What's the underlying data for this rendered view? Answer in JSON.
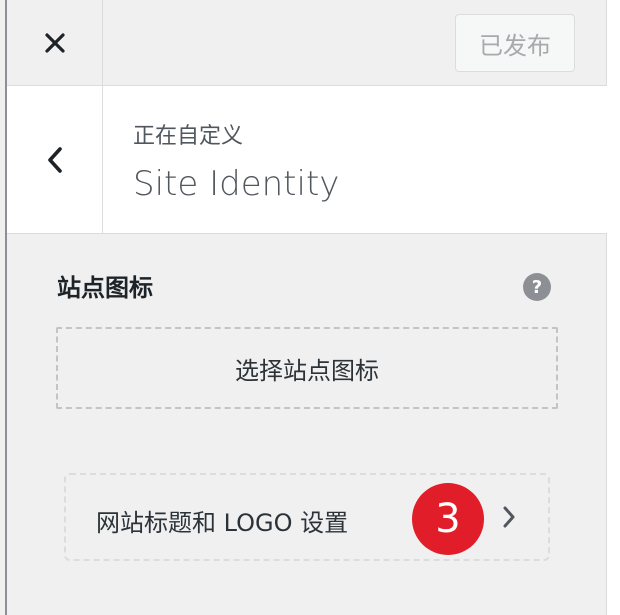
{
  "topbar": {
    "close_icon": "close-icon",
    "publish_label": "已发布"
  },
  "section": {
    "back_icon": "chevron-left-icon",
    "crumb": "正在自定义",
    "title": "Site Identity"
  },
  "site_icon": {
    "label": "站点图标",
    "help_icon": "help-icon",
    "help_glyph": "?",
    "select_label": "选择站点图标"
  },
  "title_logo": {
    "label": "网站标题和 LOGO 设置",
    "badge": "3",
    "badge_color": "#e11d2a",
    "chevron_icon": "chevron-right-icon"
  },
  "colors": {
    "panel_bg": "#f0f0f1",
    "text_dark": "#1d2327",
    "text_muted": "#50575e"
  }
}
